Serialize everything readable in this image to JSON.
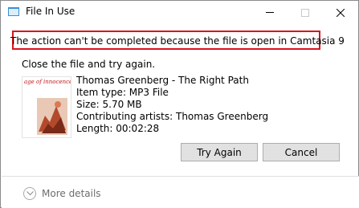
{
  "window": {
    "title": "File In Use",
    "main_message": "The action can't be completed because the file is open in Camtasia 9",
    "sub_message": "Close the file and try again."
  },
  "file": {
    "thumbnail_text": "age of innocence",
    "name": "Thomas Greenberg - The Right Path",
    "item_type": "Item type: MP3 File",
    "size": "Size: 5.70 MB",
    "artists": "Contributing artists: Thomas Greenberg",
    "length": "Length: 00:02:28"
  },
  "buttons": {
    "try_again": "Try Again",
    "cancel": "Cancel"
  },
  "footer": {
    "more_details": "More details"
  },
  "colors": {
    "highlight_border": "#d8151e",
    "button_bg": "#e1e1e1",
    "button_border": "#adadad",
    "muted_text": "#6d6d6d"
  }
}
